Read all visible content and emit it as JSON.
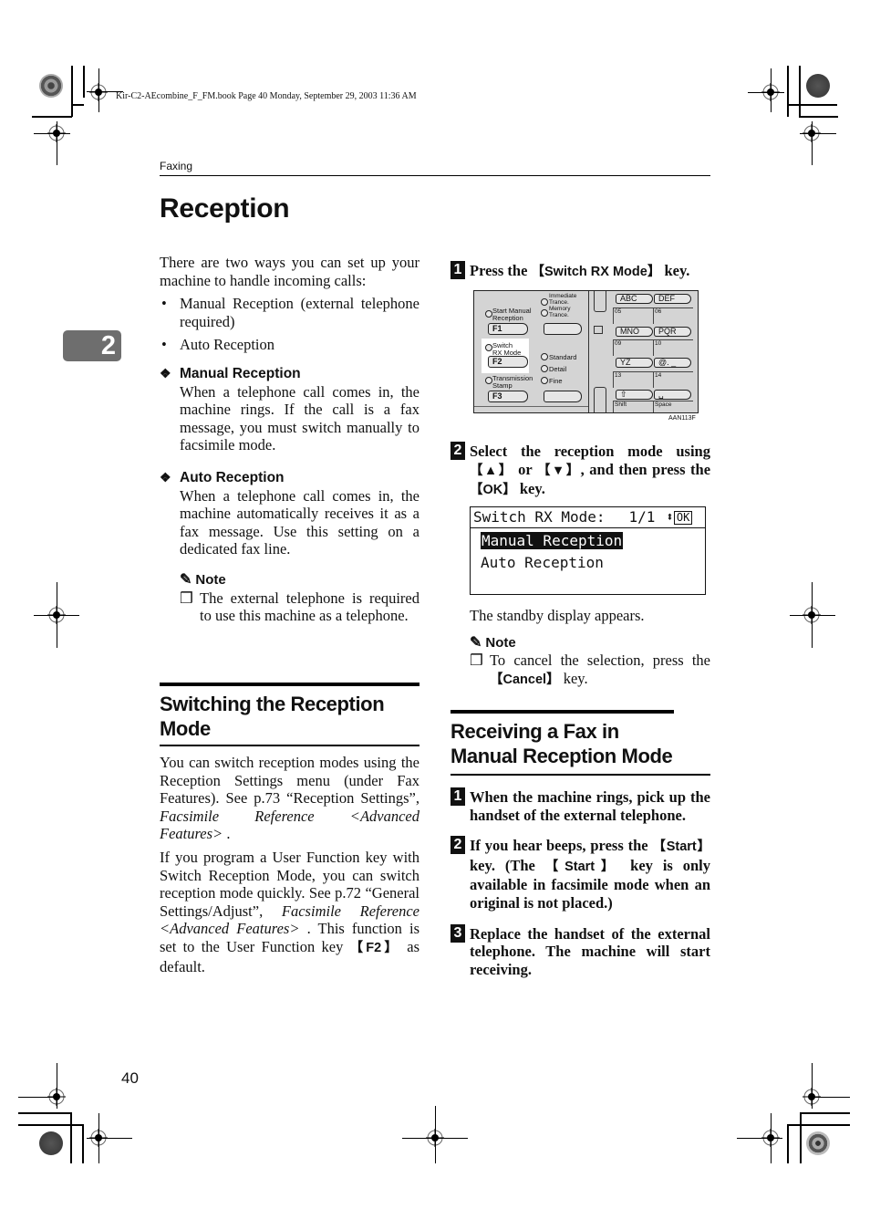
{
  "slug": "Kir-C2-AEcombine_F_FM.book  Page 40  Monday, September 29, 2003  11:36 AM",
  "running_head": "Faxing",
  "page_title": "Reception",
  "chapter_tab": "2",
  "page_number": "40",
  "left_column": {
    "intro": "There are two ways you can set up your machine to handle incoming calls:",
    "bullets": [
      "Manual Reception (external telephone required)",
      "Auto Reception"
    ],
    "definitions": [
      {
        "term": "Manual Reception",
        "text": "When a telephone call comes in, the machine rings. If the call is a fax message, you must switch manually to facsimile mode."
      },
      {
        "term": "Auto Reception",
        "text": "When a telephone call comes in, the machine automatically receives it as a fax message. Use this setting on a dedicated fax line."
      }
    ],
    "note": {
      "title": "Note",
      "items": [
        "The external telephone is required to use this machine as a telephone."
      ]
    },
    "section": {
      "heading": "Switching the Reception Mode",
      "para1": {
        "text": "You can switch reception modes using the Reception Settings menu (under Fax Features). See p.73 “Reception Settings”, ",
        "ref": "Facsimile Reference <Advanced Features>",
        "tail": " ."
      },
      "para2": {
        "text": "If you program a User Function key with Switch Reception Mode, you can switch reception mode quickly. See p.72 “General Settings/Adjust”, ",
        "ref": "Facsimile Reference <Advanced Features>",
        "tail": " . This function is set to the User Function key ",
        "key": "F2",
        "end": " as default."
      }
    }
  },
  "right_column": {
    "steps_a": [
      {
        "num": "1",
        "before": "Press the ",
        "key": "Switch RX Mode",
        "after": " key."
      },
      {
        "num": "2",
        "before": "Select the reception mode using ",
        "key1": "▲",
        "mid": " or ",
        "key2": "▼",
        "mid2": ", and then press the ",
        "key3": "OK",
        "after": " key."
      }
    ],
    "panel": {
      "labels": {
        "start_manual": "Start Manual\nReception",
        "immediate": "Immediate\nTrance.",
        "memory": "Memory\nTrance.",
        "switch_rx": "Switch\nRX Mode",
        "standard": "Standard",
        "detail": "Detail",
        "fine": "Fine",
        "transmission_stamp": "Transmission\nStamp"
      },
      "fkeys": [
        "F1",
        "F2",
        "F3"
      ],
      "one_touch_rows": [
        {
          "keys": [
            "ABC",
            "DEF"
          ],
          "cells": [
            "05",
            "06"
          ]
        },
        {
          "keys": [
            "MNO",
            "PQR"
          ],
          "cells": [
            "09",
            "10"
          ]
        },
        {
          "keys": [
            "YZ",
            "@. _"
          ],
          "cells": [
            "13",
            "14"
          ]
        },
        {
          "keys": [
            "⇧",
            "␣"
          ],
          "cells": [
            "Shift",
            "Space"
          ]
        }
      ],
      "figure_code": "AAN113F"
    },
    "lcd": {
      "title": "Switch RX Mode:",
      "page": "1/1",
      "ok": "OK",
      "options": [
        {
          "label": "Manual Reception",
          "selected": true
        },
        {
          "label": "Auto Reception",
          "selected": false
        }
      ]
    },
    "standby_text": "The standby display appears.",
    "note": {
      "title": "Note",
      "before": "To cancel the selection, press the ",
      "key": "Cancel",
      "after": " key."
    },
    "section": {
      "heading": "Receiving a Fax in Manual Reception Mode",
      "steps": [
        {
          "num": "1",
          "text": "When the machine rings, pick up the handset of the external telephone."
        },
        {
          "num": "2",
          "before": "If you hear beeps, press the ",
          "key": "Start",
          "mid": " key. (The ",
          "key2": "Start",
          "after": " key is only available in facsimile mode when an original is not placed.)"
        },
        {
          "num": "3",
          "text": "Replace the handset of the external telephone. The machine will start receiving."
        }
      ]
    }
  }
}
